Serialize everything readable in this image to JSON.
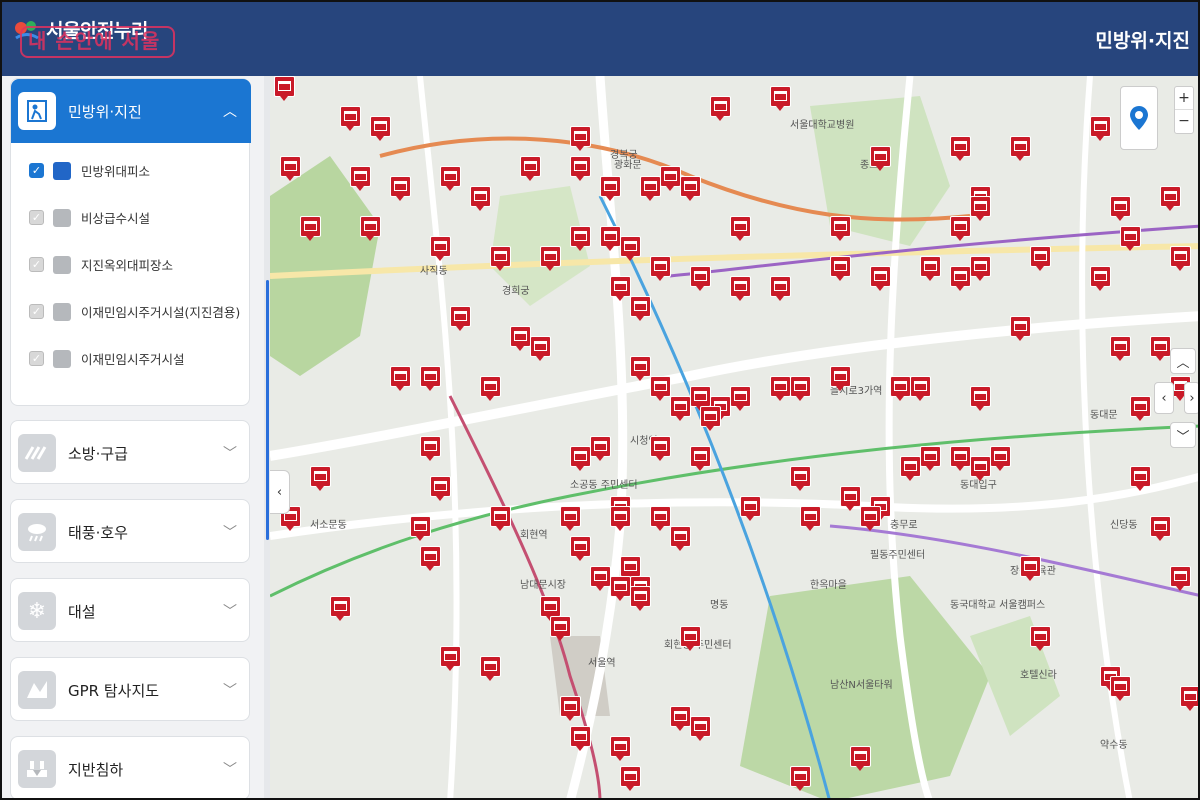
{
  "header": {
    "brand": "서울안전누리",
    "watermark": "내 손안에 서울",
    "title": "민방위·지진"
  },
  "sidebar": {
    "active_panel": {
      "label": "민방위·지진",
      "icon": "civil-defense-icon",
      "items": [
        {
          "label": "민방위대피소",
          "checked": true
        },
        {
          "label": "비상급수시설",
          "checked": false
        },
        {
          "label": "지진옥외대피장소",
          "checked": false
        },
        {
          "label": "이재민임시주거시설(지진겸용)",
          "checked": false
        },
        {
          "label": "이재민임시주거시설",
          "checked": false
        }
      ]
    },
    "panels": [
      {
        "label": "소방·구급",
        "icon": "fire-rescue-icon"
      },
      {
        "label": "태풍·호우",
        "icon": "storm-rain-icon"
      },
      {
        "label": "대설",
        "icon": "snowflake-icon"
      },
      {
        "label": "GPR 탐사지도",
        "icon": "gpr-map-icon"
      },
      {
        "label": "지반침하",
        "icon": "ground-subsidence-icon"
      }
    ]
  },
  "map": {
    "zoom_in": "+",
    "zoom_out": "−",
    "labels": [
      "경복궁",
      "서울대학교병원",
      "종묘",
      "경희궁",
      "시청역",
      "서울역",
      "남산N서울타워",
      "동대문",
      "신당동",
      "명동",
      "을지로3가역",
      "충무로",
      "회현동 주민센터",
      "광화문",
      "사직동",
      "한옥마을",
      "남대문시장",
      "동대입구",
      "장충체육관",
      "필동주민센터",
      "소공동 주민센터",
      "서소문동",
      "약수동",
      "회현역",
      "호텔신라",
      "동국대학교 서울캠퍼스"
    ]
  },
  "colors": {
    "header_bg": "#27457d",
    "active_panel_bg": "#1b76d2",
    "pin": "#c91a28"
  }
}
